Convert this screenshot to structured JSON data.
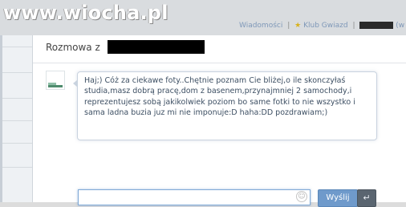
{
  "watermark": {
    "text": "www.wiocha.pl"
  },
  "top_nav": {
    "messages_label": "Wiadomości",
    "separator": "|",
    "star_glyph": "★",
    "club_label": "Klub Gwiazd",
    "tail": "(w"
  },
  "conversation": {
    "title": "Rozmowa z",
    "message": "Haj;) Cóż za ciekawe foty..Chętnie poznam Cie bliżej,o ile skonczyłaś studia,masz dobrą pracę,dom z basenem,przynajmniej 2 samochody,i reprezentujesz sobą jakikolwiek poziom bo same fotki to nie wszystko i sama ladna buzia juz mi nie imponuje:D haha:DD pozdrawiam;)"
  },
  "composer": {
    "input_value": "",
    "smiley_glyph": "☺",
    "send_label": "Wyślij",
    "enter_glyph": "↵"
  }
}
